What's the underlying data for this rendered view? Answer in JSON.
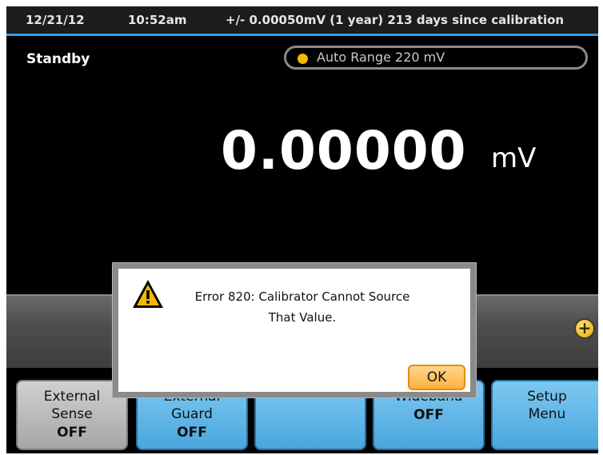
{
  "status": {
    "date": "12/21/12",
    "time": "10:52am",
    "accuracy": "+/- 0.00050mV (1 year)  213 days since calibration"
  },
  "mode": "Standby",
  "range": {
    "label": "Auto Range 220 mV",
    "indicator_color": "#f5b800"
  },
  "reading": {
    "value": "0.00000",
    "unit": "mV"
  },
  "dialog": {
    "message_line1": "Error 820: Calibrator Cannot Source",
    "message_line2": "That Value.",
    "ok_label": "OK",
    "icon": "warning-icon"
  },
  "control_band": {
    "plus_icon": "+"
  },
  "softkeys": [
    {
      "line1": "External",
      "line2": "Sense",
      "state": "OFF"
    },
    {
      "line1": "External",
      "line2": "Guard",
      "state": "OFF"
    },
    {
      "line1": "",
      "line2": "",
      "state": ""
    },
    {
      "line1": "Wideband",
      "line2": "",
      "state": "OFF"
    },
    {
      "line1": "Setup",
      "line2": "Menu",
      "state": ""
    }
  ],
  "colors": {
    "accent": "#2aa5e6",
    "softkey": "#5fb6e8",
    "warning": "#f5b800"
  }
}
